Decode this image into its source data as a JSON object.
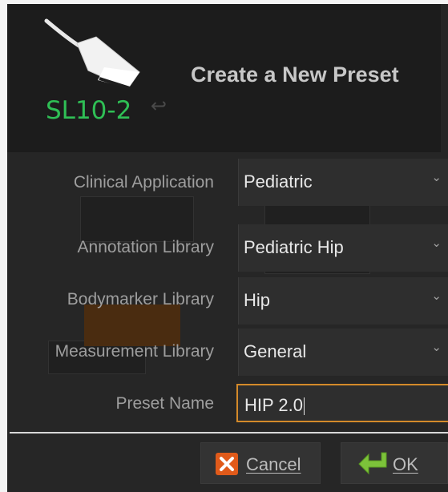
{
  "probe": {
    "name": "SL10-2",
    "icon": "ultrasound-probe-icon"
  },
  "dialog": {
    "title": "Create a New Preset"
  },
  "fields": [
    {
      "label": "Clinical Application",
      "value": "Pediatric"
    },
    {
      "label": "Annotation Library",
      "value": "Pediatric Hip"
    },
    {
      "label": "Bodymarker Library",
      "value": "Hip"
    },
    {
      "label": "Measurement Library",
      "value": "General"
    }
  ],
  "preset_name": {
    "label": "Preset Name",
    "value": "HIP 2.0"
  },
  "buttons": {
    "cancel": {
      "label": "Cancel",
      "icon": "x-icon"
    },
    "ok": {
      "label": "OK",
      "icon": "enter-arrow-icon"
    }
  },
  "colors": {
    "accent": "#d48a2a",
    "probe_name": "#2fbf55",
    "cancel_icon": "#e05a1a",
    "ok_icon": "#7cc23a"
  }
}
